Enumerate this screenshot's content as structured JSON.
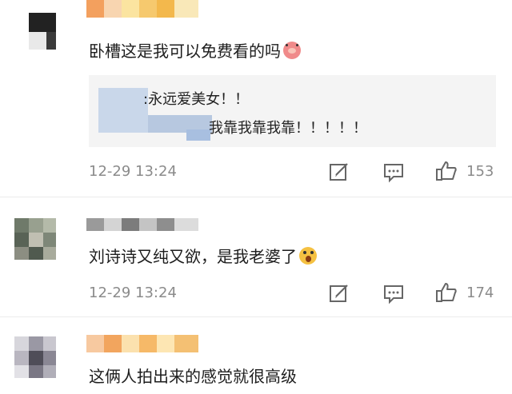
{
  "colors": {
    "meta_gray": "#8b8b8b",
    "reply_bg": "#f4f4f4",
    "divider": "#ebebeb"
  },
  "comments": [
    {
      "text": "卧槽这是我可以免费看的吗",
      "emoji": "pig-face-emoji",
      "reply": {
        "line1": ":永远爱美女！！",
        "line2": "我靠我靠我靠！！！！！"
      },
      "time": "12-29 13:24",
      "likes": "153"
    },
    {
      "text": "刘诗诗又纯又欲，是我老婆了",
      "emoji": "shocked-face-emoji",
      "time": "12-29 13:24",
      "likes": "174"
    },
    {
      "text": "这俩人拍出来的感觉就很高级"
    }
  ],
  "icons": {
    "repost": "repost-icon",
    "comment": "comment-icon",
    "like": "thumbs-up-icon"
  }
}
